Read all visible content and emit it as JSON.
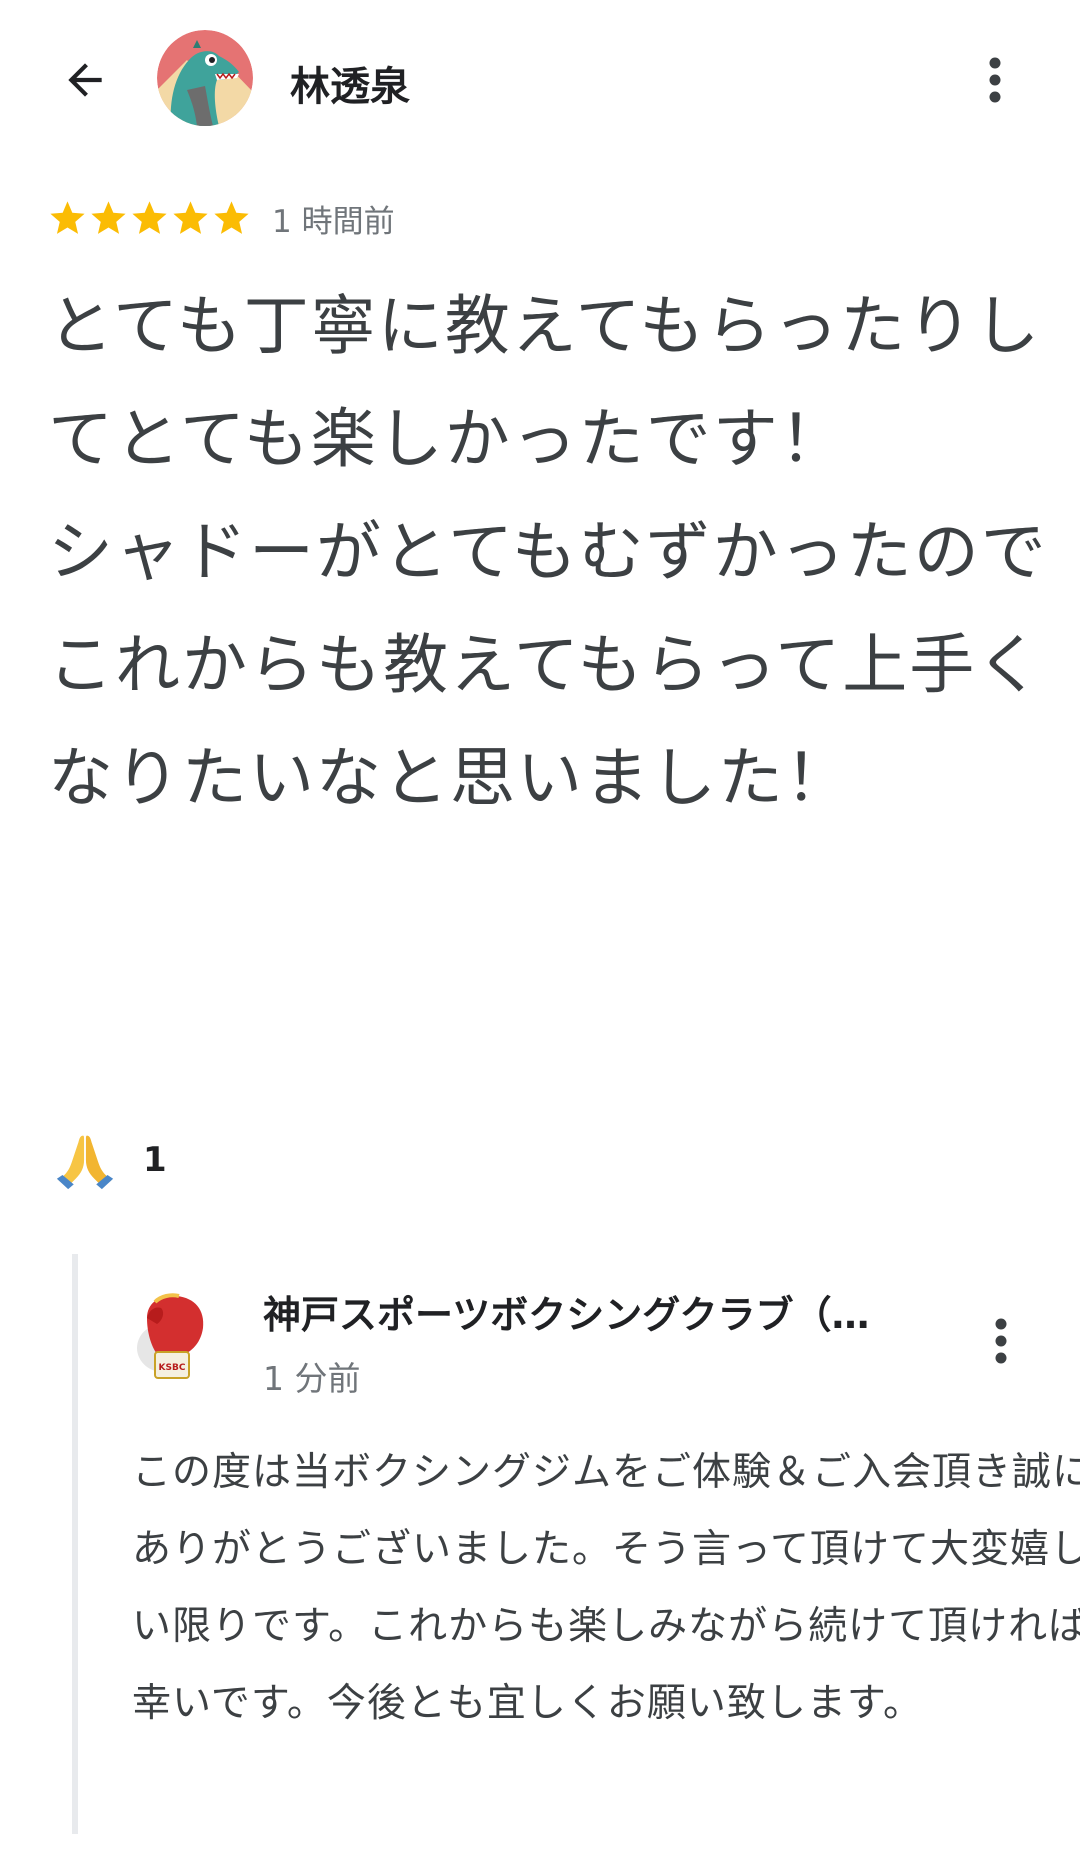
{
  "header": {
    "author_name": "林透泉",
    "back_icon": "arrow-left-icon",
    "menu_icon": "more-vert-icon",
    "avatar": "dinosaur-avatar"
  },
  "review": {
    "rating": 5,
    "max_rating": 5,
    "star_color": "#fbbc04",
    "time_ago": "1 時間前",
    "text": "とても丁寧に教えてもらったりしてとても楽しかったです！\nシャドーがとてもむずかったのでこれからも教えてもらって上手くなりたいなと思いました！"
  },
  "reactions": {
    "icon": "folded-hands-icon",
    "count": "1"
  },
  "owner_reply": {
    "name": "神戸スポーツボクシングクラブ（…",
    "time_ago": "1 分前",
    "logo_text": "KSBC",
    "text": "この度は当ボクシングジムをご体験＆ご入会頂き誠にありがとうございました。そう言って頂けて大変嬉しい限りです。これからも楽しみながら続けて頂ければ幸いです。今後とも宜しくお願い致します。"
  },
  "colors": {
    "primary_text": "#3c4043",
    "secondary_text": "#70757a",
    "divider": "#e8eaed"
  }
}
